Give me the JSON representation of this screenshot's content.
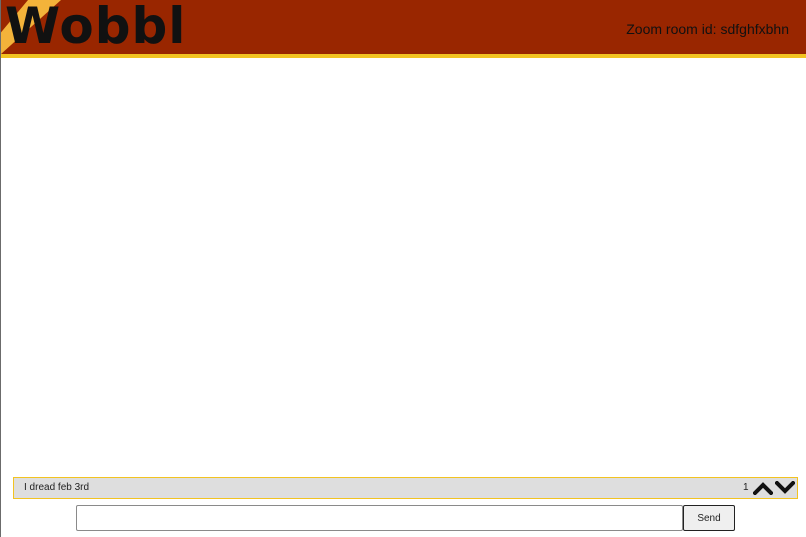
{
  "header": {
    "logo_text": "Wobbl",
    "room_label": "Zoom room id:",
    "room_id": "sdfghfxbhn"
  },
  "messages": [
    {
      "text": "I dread feb 3rd",
      "votes": "1"
    }
  ],
  "composer": {
    "input_value": "",
    "send_label": "Send"
  },
  "icons": {
    "upvote": "chevron-up-icon",
    "downvote": "chevron-down-icon"
  },
  "colors": {
    "header_bg": "#992600",
    "accent": "#f2c321",
    "logo_wedge": "#f3b33a",
    "message_bg": "#dedede"
  }
}
